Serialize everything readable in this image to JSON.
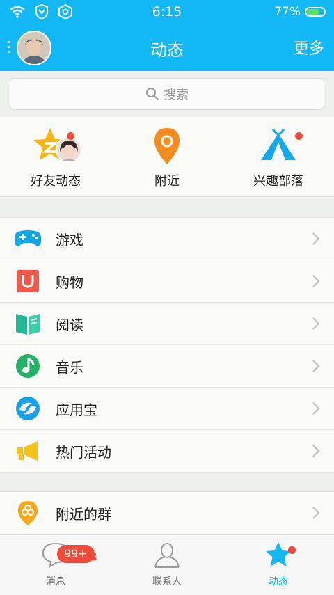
{
  "status": {
    "time": "6:15",
    "battery_text": "77%",
    "battery_level": 0.77
  },
  "header": {
    "title": "动态",
    "more_label": "更多"
  },
  "search": {
    "placeholder": "搜索"
  },
  "quick": [
    {
      "label": "好友动态",
      "icon": "star-z-icon"
    },
    {
      "label": "附近",
      "icon": "location-pin-icon"
    },
    {
      "label": "兴趣部落",
      "icon": "tent-icon"
    }
  ],
  "menu1": [
    {
      "label": "游戏",
      "icon": "gamepad-icon"
    },
    {
      "label": "购物",
      "icon": "shopping-bag-icon"
    },
    {
      "label": "阅读",
      "icon": "book-icon"
    },
    {
      "label": "音乐",
      "icon": "music-note-icon"
    },
    {
      "label": "应用宝",
      "icon": "app-store-icon"
    },
    {
      "label": "热门活动",
      "icon": "megaphone-icon"
    }
  ],
  "menu2": [
    {
      "label": "附近的群",
      "icon": "nearby-group-icon"
    }
  ],
  "tabs": [
    {
      "label": "消息",
      "badge": "99+"
    },
    {
      "label": "联系人"
    },
    {
      "label": "动态"
    }
  ],
  "colors": {
    "brand": "#12b7f5",
    "badge_red": "#f04b3a"
  }
}
